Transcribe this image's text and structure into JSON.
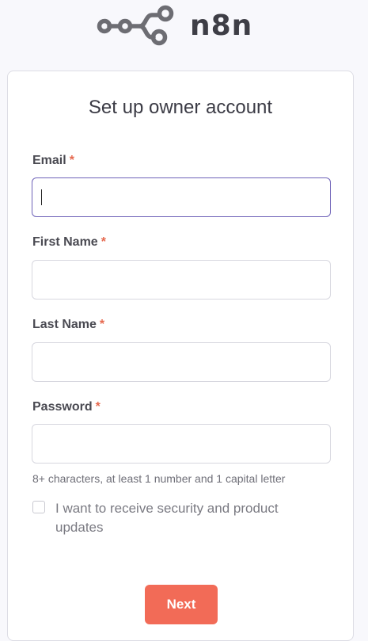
{
  "logo": {
    "text": "n8n",
    "icon": "n8n-logo-icon",
    "color": "#6d6d73"
  },
  "form": {
    "title": "Set up owner account",
    "required_marker": "*",
    "fields": [
      {
        "label": "Email",
        "value": "",
        "placeholder": "",
        "focused": true
      },
      {
        "label": "First Name",
        "value": "",
        "placeholder": ""
      },
      {
        "label": "Last Name",
        "value": "",
        "placeholder": ""
      },
      {
        "label": "Password",
        "value": "",
        "placeholder": ""
      }
    ],
    "password_hint": "8+ characters, at least 1 number and 1 capital letter",
    "updates_checkbox": {
      "label": "I want to receive security and product updates",
      "checked": false
    },
    "next_label": "Next"
  },
  "colors": {
    "accent": "#f26b57",
    "required": "#e6694f",
    "focus_border": "#6e62b8",
    "background": "#f8f8fc"
  }
}
